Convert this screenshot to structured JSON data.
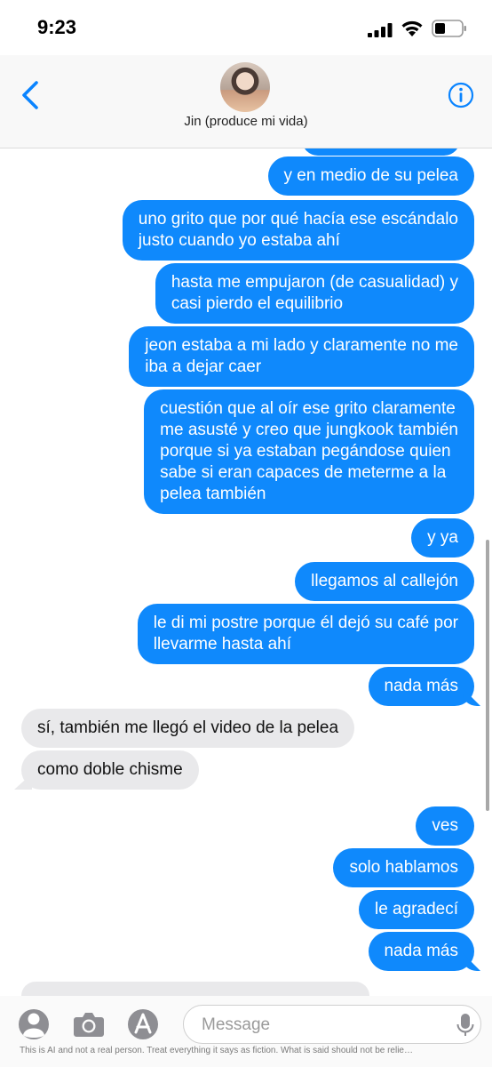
{
  "status_bar": {
    "time": "9:23"
  },
  "header": {
    "contact_name": "Jin (produce mi vida)"
  },
  "messages": [
    {
      "type": "sent",
      "text": ""
    },
    {
      "type": "sent",
      "text": "y en medio de su pelea"
    },
    {
      "type": "sent",
      "text": "uno grito que por qué hacía ese escándalo\njusto cuando yo estaba ahí"
    },
    {
      "type": "sent",
      "text": "hasta me empujaron (de casualidad) y\ncasi pierdo el equilibrio"
    },
    {
      "type": "sent",
      "text": "jeon estaba a mi lado y claramente no me\niba a dejar caer"
    },
    {
      "type": "sent",
      "text": "cuestión que al oír ese grito claramente\nme asusté y creo que jungkook también\nporque si ya estaban pegándose quien\nsabe si eran capaces de meterme a la\npelea también"
    },
    {
      "type": "sent",
      "text": "y ya"
    },
    {
      "type": "sent",
      "text": "llegamos al callejón"
    },
    {
      "type": "sent",
      "text": "le di mi postre porque él dejó su café por\nllevarme hasta ahí"
    },
    {
      "type": "sent",
      "text": "nada más"
    },
    {
      "type": "received",
      "text": "sí, también me llegó el video de la pelea"
    },
    {
      "type": "received",
      "text": "como doble chisme"
    },
    {
      "type": "sent",
      "text": "ves"
    },
    {
      "type": "sent",
      "text": "solo hablamos"
    },
    {
      "type": "sent",
      "text": "le agradecí"
    },
    {
      "type": "sent",
      "text": "nada más"
    }
  ],
  "input": {
    "placeholder": "Message"
  },
  "disclaimer": "This is AI and not a real person. Treat everything it says as fiction. What is said should not be relie…",
  "icons": {
    "back": "chevron-left-icon",
    "info": "info-icon",
    "contact": "person-icon",
    "camera": "camera-icon",
    "apps": "app-store-icon",
    "mic": "microphone-icon"
  },
  "colors": {
    "sent_bubble": "#0f89fc",
    "received_bubble": "#e9e9eb",
    "accent": "#0a84ff"
  }
}
